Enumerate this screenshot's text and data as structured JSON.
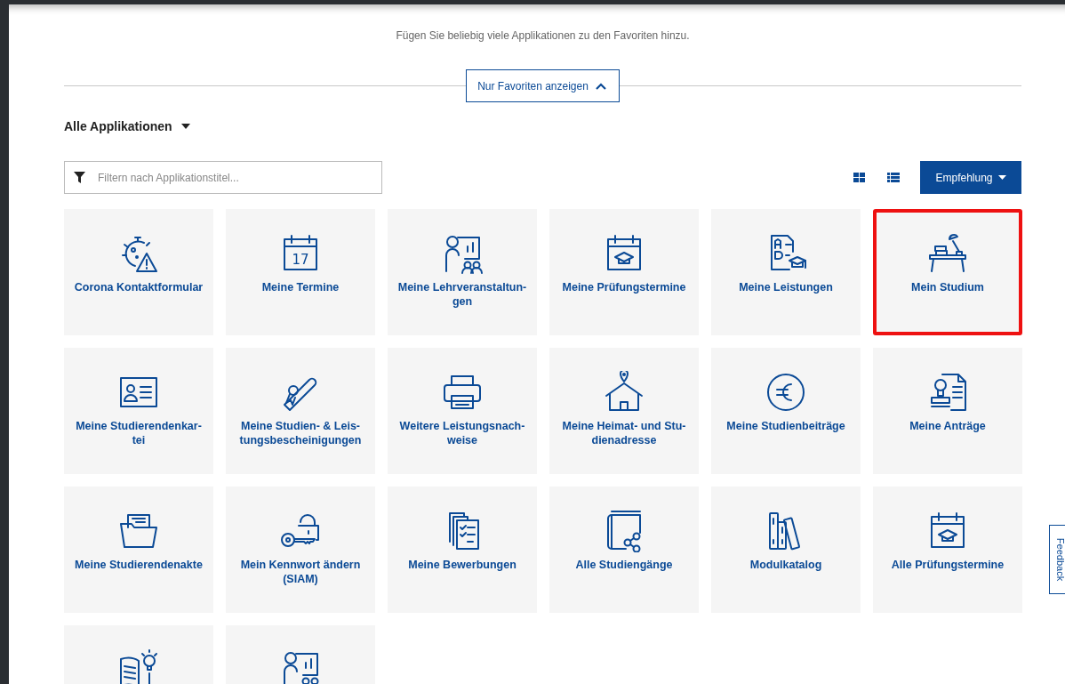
{
  "subtitle": "Fügen Sie beliebig viele Applikationen zu den Favoriten hinzu.",
  "favorites_toggle": {
    "label": "Nur Favoriten anzeigen",
    "expanded": true
  },
  "section_title": "Alle Applikationen",
  "filter": {
    "placeholder": "Filtern nach Applikationstitel..."
  },
  "sort_button": "Empfehlung",
  "tiles": [
    {
      "kind": "virus",
      "label": "Corona Kontaktformular",
      "highlighted": false
    },
    {
      "kind": "calendar",
      "calendar_day": "17",
      "label": "Meine Termine",
      "highlighted": false
    },
    {
      "kind": "presenter",
      "label": "Meine Lehrveranstaltun-\ngen",
      "highlighted": false
    },
    {
      "kind": "exam",
      "label": "Meine Prüfungstermine",
      "highlighted": false
    },
    {
      "kind": "grades",
      "label": "Meine Leistungen",
      "highlighted": false
    },
    {
      "kind": "desk",
      "label": "Mein Studium",
      "highlighted": true
    },
    {
      "kind": "idcard",
      "label": "Meine Studierendenkar-\ntei",
      "highlighted": false
    },
    {
      "kind": "diploma",
      "label": "Meine Studien- & Leis-\ntungsbescheinigungen",
      "highlighted": false
    },
    {
      "kind": "printer",
      "label": "Weitere Leistungsnach-\nweise",
      "highlighted": false
    },
    {
      "kind": "house",
      "label": "Meine Heimat- und Stu-\ndienadresse",
      "highlighted": false
    },
    {
      "kind": "euro",
      "label": "Meine Studienbeiträge",
      "highlighted": false
    },
    {
      "kind": "stamp",
      "label": "Meine Anträge",
      "highlighted": false
    },
    {
      "kind": "folder",
      "label": "Meine Studierendenakte",
      "highlighted": false
    },
    {
      "kind": "key",
      "label": "Mein Kennwort ändern\n(SIAM)",
      "highlighted": false
    },
    {
      "kind": "checklist",
      "label": "Meine Bewerbungen",
      "highlighted": false
    },
    {
      "kind": "bookshare",
      "label": "Alle Studiengänge",
      "highlighted": false
    },
    {
      "kind": "books",
      "label": "Modulkatalog",
      "highlighted": false
    },
    {
      "kind": "exam",
      "label": "Alle Prüfungstermine",
      "highlighted": false
    },
    {
      "kind": "idea",
      "highlighted": false
    },
    {
      "kind": "presenter",
      "highlighted": false
    }
  ],
  "feedback_tab": "Feedback"
}
